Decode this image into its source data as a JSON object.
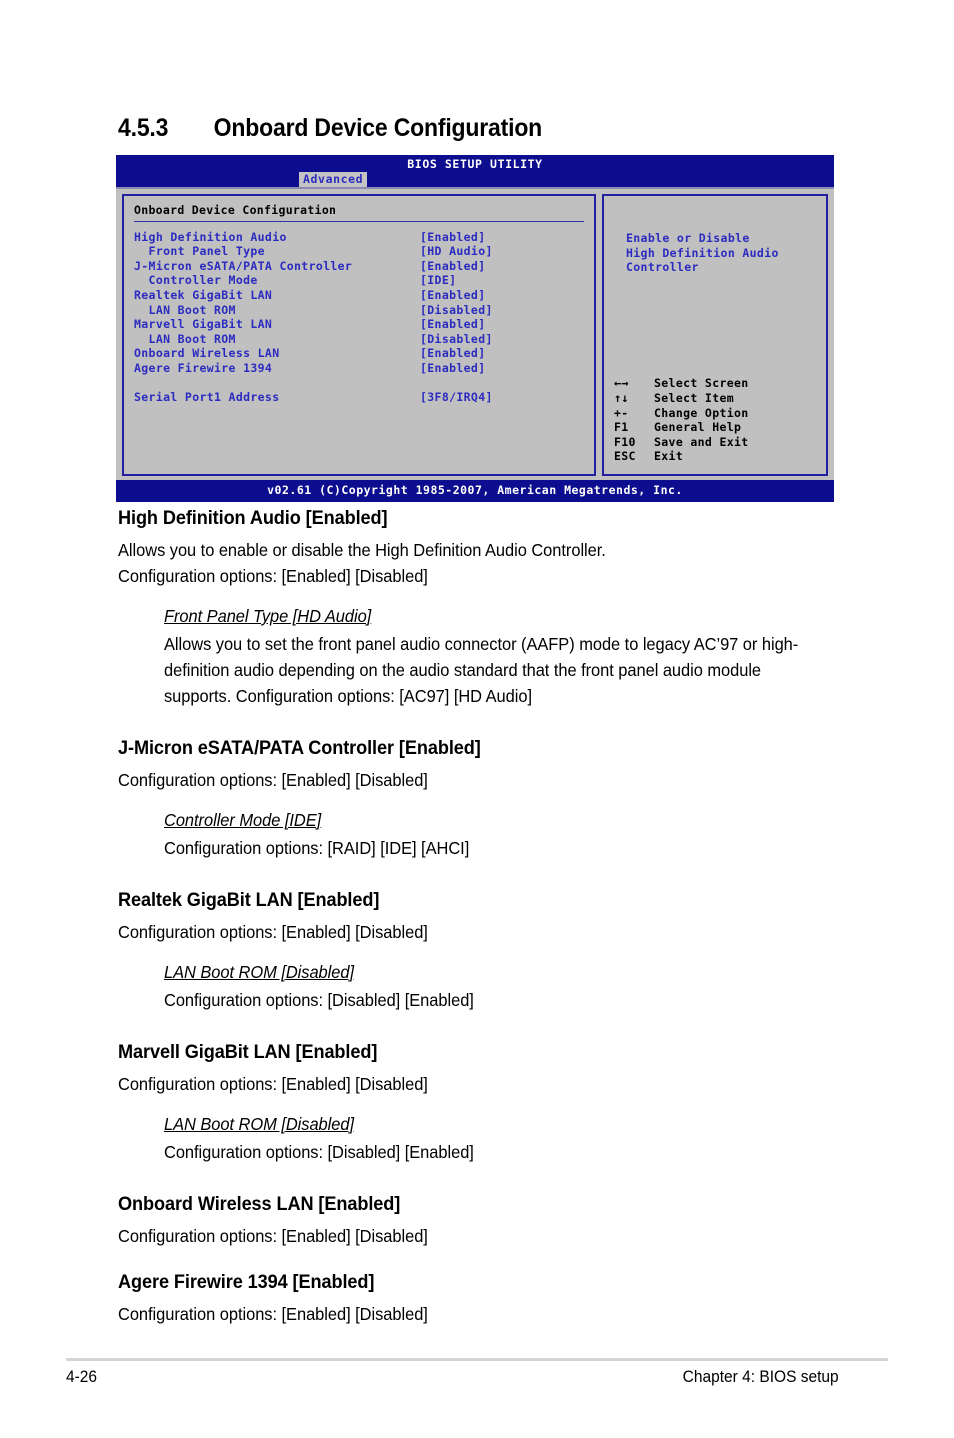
{
  "section": {
    "number": "4.5.3",
    "title": "Onboard Device Configuration"
  },
  "bios": {
    "utility_title": "BIOS SETUP UTILITY",
    "active_tab": "Advanced",
    "panel_header": "Onboard Device Configuration",
    "options": [
      {
        "label": "High Definition Audio",
        "value": "[Enabled]"
      },
      {
        "label": "  Front Panel Type",
        "value": "[HD Audio]"
      },
      {
        "label": "J-Micron eSATA/PATA Controller",
        "value": "[Enabled]"
      },
      {
        "label": "  Controller Mode",
        "value": "[IDE]"
      },
      {
        "label": "Realtek GigaBit LAN",
        "value": "[Enabled]"
      },
      {
        "label": "  LAN Boot ROM",
        "value": "[Disabled]"
      },
      {
        "label": "Marvell GigaBit LAN",
        "value": "[Enabled]"
      },
      {
        "label": "  LAN Boot ROM",
        "value": "[Disabled]"
      },
      {
        "label": "Onboard Wireless LAN",
        "value": "[Enabled]"
      },
      {
        "label": "Agere Firewire 1394",
        "value": "[Enabled]"
      },
      {
        "label": "",
        "value": ""
      },
      {
        "label": "Serial Port1 Address",
        "value": "[3F8/IRQ4]"
      }
    ],
    "help_text": "Enable or Disable\nHigh Definition Audio\nController",
    "legend": [
      {
        "key": "←→",
        "desc": "Select Screen",
        "icon": "left-right-arrow-icon"
      },
      {
        "key": "↑↓",
        "desc": "Select Item",
        "icon": "up-down-arrow-icon"
      },
      {
        "key": "+-",
        "desc": "Change Option",
        "icon": "plus-minus-icon"
      },
      {
        "key": "F1",
        "desc": "General Help",
        "icon": "f1-key-icon"
      },
      {
        "key": "F10",
        "desc": "Save and Exit",
        "icon": "f10-key-icon"
      },
      {
        "key": "ESC",
        "desc": "Exit",
        "icon": "esc-key-icon"
      }
    ],
    "copyright": "v02.61 (C)Copyright 1985-2007, American Megatrends, Inc.",
    "colors": {
      "title_bar": "#0d0d8f",
      "panel_bg": "#c0c0c0",
      "option_text": "#2b2bbf",
      "panel_border": "#2020a0"
    }
  },
  "content": {
    "items": [
      {
        "heading": "High Definition Audio [Enabled]",
        "body": "Allows you to enable or disable the High Definition Audio Controller.\nConfiguration options: [Enabled] [Disabled]",
        "sub": {
          "heading": "Front Panel Type [HD Audio]",
          "body": "Allows you to set the front panel audio connector (AAFP) mode to legacy AC’97 or high-definition audio depending on the audio standard that the front panel audio module supports. Configuration options: [AC97] [HD Audio]"
        }
      },
      {
        "heading": "J-Micron eSATA/PATA Controller [Enabled]",
        "body": "Configuration options: [Enabled] [Disabled]",
        "sub": {
          "heading": "Controller Mode [IDE]",
          "body": "Configuration options: [RAID] [IDE] [AHCI]"
        }
      },
      {
        "heading": "Realtek GigaBit LAN [Enabled]",
        "body": "Configuration options: [Enabled] [Disabled]",
        "sub": {
          "heading": "LAN Boot ROM [Disabled]",
          "body": "Configuration options: [Disabled] [Enabled]"
        }
      },
      {
        "heading": "Marvell GigaBit LAN [Enabled]",
        "body": "Configuration options: [Enabled] [Disabled]",
        "sub": {
          "heading": "LAN Boot ROM [Disabled]",
          "body": "Configuration options: [Disabled] [Enabled]"
        }
      },
      {
        "heading": "Onboard Wireless LAN [Enabled]",
        "body": "Configuration options: [Enabled] [Disabled]",
        "sub": null
      },
      {
        "heading": "Agere Firewire 1394 [Enabled]",
        "body": "Configuration options: [Enabled] [Disabled]",
        "sub": null
      }
    ]
  },
  "footer": {
    "page_number": "4-26",
    "chapter": "Chapter 4: BIOS setup"
  }
}
